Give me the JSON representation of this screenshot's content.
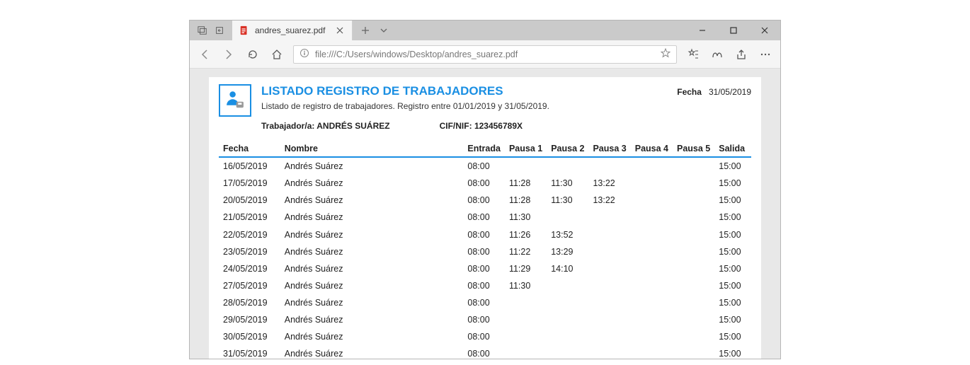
{
  "browser": {
    "tab_title": "andres_suarez.pdf",
    "url": "file:///C:/Users/windows/Desktop/andres_suarez.pdf"
  },
  "report": {
    "title": "LISTADO REGISTRO DE TRABAJADORES",
    "subtitle": "Listado de registro de trabajadores. Registro entre 01/01/2019 y 31/05/2019.",
    "worker_label": "Trabajador/a:",
    "worker_name": "ANDRÉS SUÁREZ",
    "cif_label": "CIF/NIF:",
    "cif_value": "123456789X",
    "date_label": "Fecha",
    "date_value": "31/05/2019"
  },
  "columns": {
    "fecha": "Fecha",
    "nombre": "Nombre",
    "entrada": "Entrada",
    "p1": "Pausa 1",
    "p2": "Pausa 2",
    "p3": "Pausa 3",
    "p4": "Pausa 4",
    "p5": "Pausa 5",
    "salida": "Salida"
  },
  "rows": [
    {
      "fecha": "16/05/2019",
      "nombre": "Andrés Suárez",
      "entrada": "08:00",
      "p1": "",
      "p2": "",
      "p3": "",
      "p4": "",
      "p5": "",
      "salida": "15:00"
    },
    {
      "fecha": "17/05/2019",
      "nombre": "Andrés Suárez",
      "entrada": "08:00",
      "p1": "11:28",
      "p2": "11:30",
      "p3": "13:22",
      "p4": "",
      "p5": "",
      "salida": "15:00"
    },
    {
      "fecha": "20/05/2019",
      "nombre": "Andrés Suárez",
      "entrada": "08:00",
      "p1": "11:28",
      "p2": "11:30",
      "p3": "13:22",
      "p4": "",
      "p5": "",
      "salida": "15:00"
    },
    {
      "fecha": "21/05/2019",
      "nombre": "Andrés Suárez",
      "entrada": "08:00",
      "p1": "11:30",
      "p2": "",
      "p3": "",
      "p4": "",
      "p5": "",
      "salida": "15:00"
    },
    {
      "fecha": "22/05/2019",
      "nombre": "Andrés Suárez",
      "entrada": "08:00",
      "p1": "11:26",
      "p2": "13:52",
      "p3": "",
      "p4": "",
      "p5": "",
      "salida": "15:00"
    },
    {
      "fecha": "23/05/2019",
      "nombre": "Andrés Suárez",
      "entrada": "08:00",
      "p1": "11:22",
      "p2": "13:29",
      "p3": "",
      "p4": "",
      "p5": "",
      "salida": "15:00"
    },
    {
      "fecha": "24/05/2019",
      "nombre": "Andrés Suárez",
      "entrada": "08:00",
      "p1": "11:29",
      "p2": "14:10",
      "p3": "",
      "p4": "",
      "p5": "",
      "salida": "15:00"
    },
    {
      "fecha": "27/05/2019",
      "nombre": "Andrés Suárez",
      "entrada": "08:00",
      "p1": "11:30",
      "p2": "",
      "p3": "",
      "p4": "",
      "p5": "",
      "salida": "15:00"
    },
    {
      "fecha": "28/05/2019",
      "nombre": "Andrés Suárez",
      "entrada": "08:00",
      "p1": "",
      "p2": "",
      "p3": "",
      "p4": "",
      "p5": "",
      "salida": "15:00"
    },
    {
      "fecha": "29/05/2019",
      "nombre": "Andrés Suárez",
      "entrada": "08:00",
      "p1": "",
      "p2": "",
      "p3": "",
      "p4": "",
      "p5": "",
      "salida": "15:00"
    },
    {
      "fecha": "30/05/2019",
      "nombre": "Andrés Suárez",
      "entrada": "08:00",
      "p1": "",
      "p2": "",
      "p3": "",
      "p4": "",
      "p5": "",
      "salida": "15:00"
    },
    {
      "fecha": "31/05/2019",
      "nombre": "Andrés Suárez",
      "entrada": "08:00",
      "p1": "",
      "p2": "",
      "p3": "",
      "p4": "",
      "p5": "",
      "salida": "15:00"
    }
  ]
}
